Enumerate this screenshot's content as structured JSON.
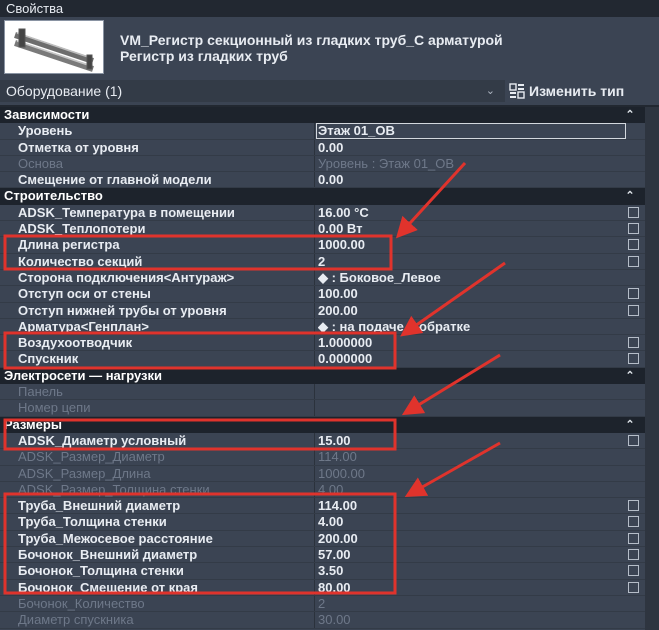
{
  "panel": {
    "title": "Свойства"
  },
  "type": {
    "name": "VM_Регистр секционный из гладких труб_С арматурой",
    "subtype": "Регистр из гладких труб",
    "thumbnail_icon": "pipe-register-icon"
  },
  "selector": {
    "label": "Оборудование (1)"
  },
  "edit_type": {
    "label": "Изменить тип",
    "icon": "edit-type-icon"
  },
  "colors": {
    "highlight": "#e0332c",
    "group_bg": "#1d232c",
    "row_bg": "#3b4453"
  },
  "groups": [
    {
      "name": "Зависимости",
      "rows": [
        {
          "name": "Уровень",
          "value": "Этаж 01_OB",
          "boxed": true
        },
        {
          "name": "Отметка от уровня",
          "value": "0.00"
        },
        {
          "name": "Основа",
          "value": "Уровень : Этаж 01_OB",
          "disabled": true
        },
        {
          "name": "Смещение от главной модели",
          "value": "0.00"
        }
      ]
    },
    {
      "name": "Строительство",
      "rows": [
        {
          "name": "ADSK_Температура в помещении",
          "value": "16.00 °C",
          "checkbox": true
        },
        {
          "name": "ADSK_Теплопотери",
          "value": "0.00 Вт",
          "checkbox": true
        },
        {
          "name": "Длина регистра",
          "value": "1000.00",
          "checkbox": true
        },
        {
          "name": "Количество секций",
          "value": "2",
          "checkbox": true
        },
        {
          "name": "Сторона подключения<Антураж>",
          "value": "◆ : Боковое_Левое"
        },
        {
          "name": "Отступ оси от стены",
          "value": "100.00",
          "checkbox": true
        },
        {
          "name": "Отступ нижней трубы от уровня",
          "value": "200.00",
          "checkbox": true
        },
        {
          "name": "Арматура<Генплан>",
          "value": "◆ : на подаче и обратке"
        },
        {
          "name": "Воздухоотводчик",
          "value": "1.000000",
          "checkbox": true
        },
        {
          "name": "Спускник",
          "value": "0.000000",
          "checkbox": true
        }
      ]
    },
    {
      "name": "Электросети — нагрузки",
      "rows": [
        {
          "name": "Панель",
          "value": "",
          "disabled": true
        },
        {
          "name": "Номер цепи",
          "value": "",
          "disabled": true
        }
      ]
    },
    {
      "name": "Размеры",
      "rows": [
        {
          "name": "ADSK_Диаметр условный",
          "value": "15.00",
          "checkbox": true
        },
        {
          "name": "ADSK_Размер_Диаметр",
          "value": "114.00",
          "disabled": true
        },
        {
          "name": "ADSK_Размер_Длина",
          "value": "1000.00",
          "disabled": true
        },
        {
          "name": "ADSK_Размер_Толщина стенки",
          "value": "4.00",
          "disabled": true
        },
        {
          "name": "Труба_Внешний диаметр",
          "value": "114.00",
          "checkbox": true
        },
        {
          "name": "Труба_Толщина стенки",
          "value": "4.00",
          "checkbox": true
        },
        {
          "name": "Труба_Межосевое расстояние",
          "value": "200.00",
          "checkbox": true
        },
        {
          "name": "Бочонок_Внешний диаметр",
          "value": "57.00",
          "checkbox": true
        },
        {
          "name": "Бочонок_Толщина стенки",
          "value": "3.50",
          "checkbox": true
        },
        {
          "name": "Бочонок_Смещение от края",
          "value": "80.00",
          "checkbox": true
        },
        {
          "name": "Бочонок_Количество",
          "value": "2",
          "disabled": true
        },
        {
          "name": "Диаметр спускника",
          "value": "30.00",
          "disabled": true
        }
      ]
    }
  ]
}
